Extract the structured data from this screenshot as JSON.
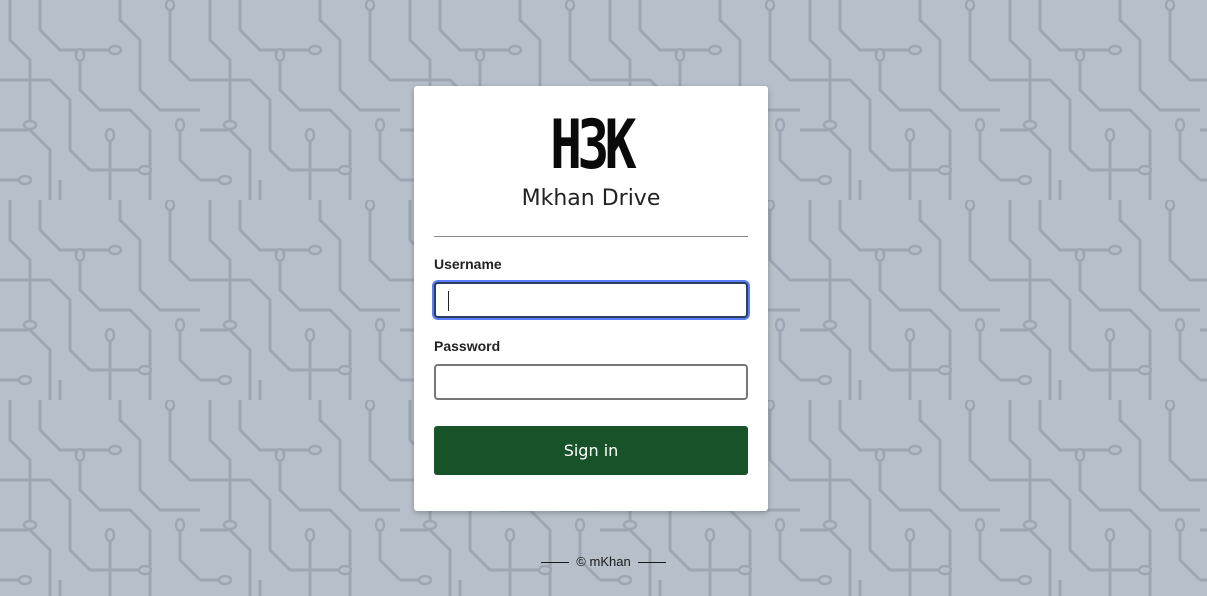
{
  "background": {
    "color": "#b7bfca",
    "trace_color": "#9da6b2",
    "pattern": "circuit-board"
  },
  "login": {
    "logo_text": "H3K",
    "app_name": "Mkhan Drive",
    "username_label": "Username",
    "username_value": "",
    "password_label": "Password",
    "password_value": "",
    "signin_label": "Sign in"
  },
  "footer": {
    "text": "© mKhan"
  },
  "colors": {
    "primary_button": "#175229",
    "focus_ring": "#5b7cf8",
    "card_background": "#ffffff"
  }
}
